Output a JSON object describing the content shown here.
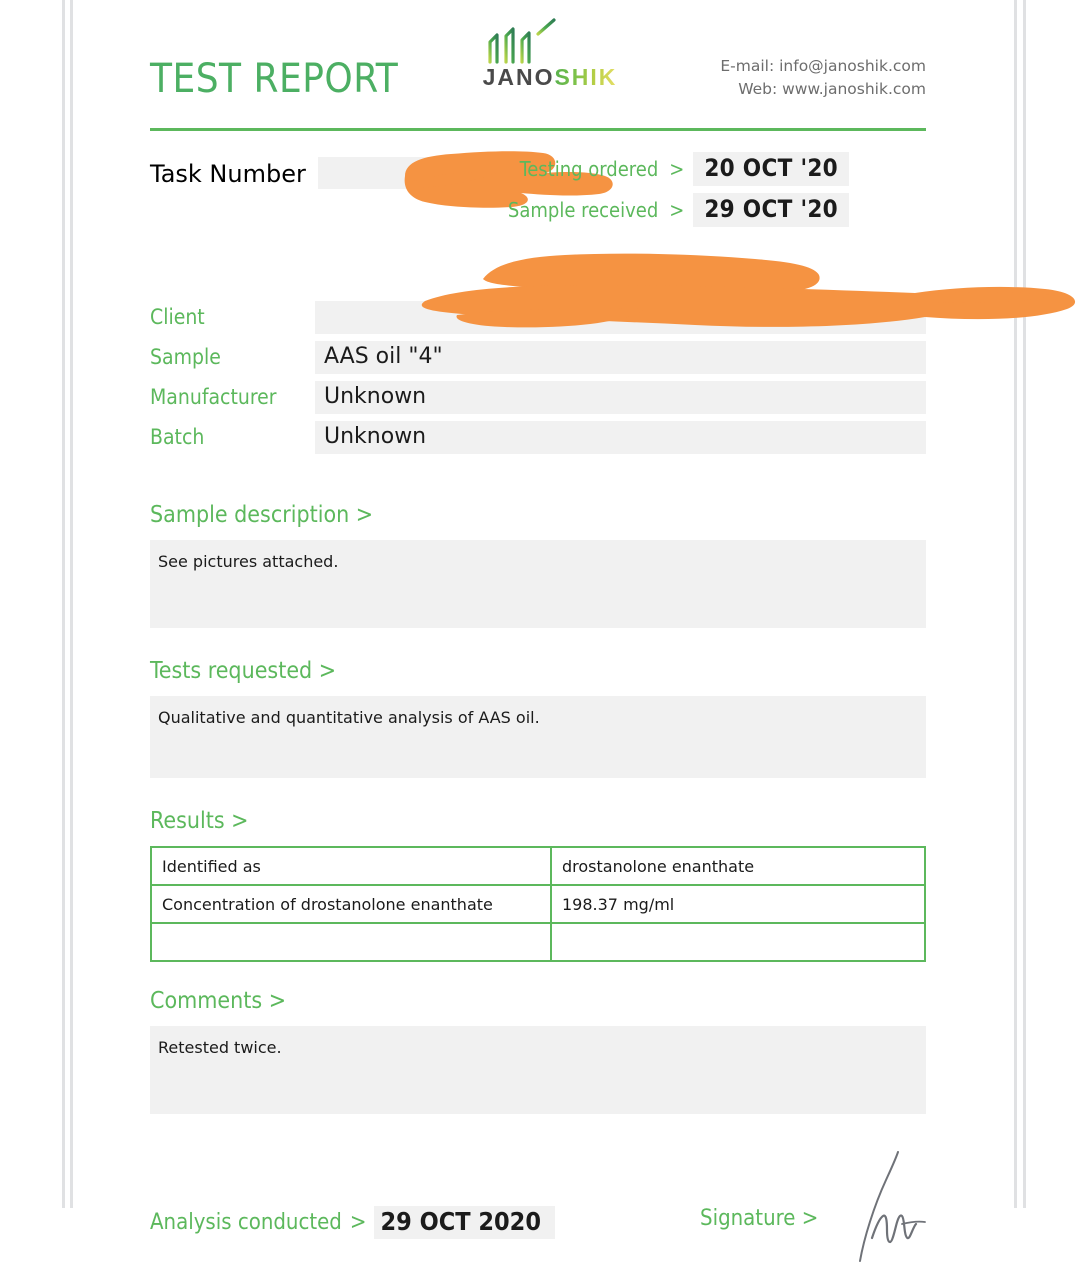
{
  "document": {
    "title": "TEST REPORT",
    "logo": {
      "name_dark": "JANO",
      "name_accent": "SHIK",
      "mark": "bar-chart-arrow-icon"
    },
    "contact": {
      "email_line": "E-mail: info@janoshik.com",
      "web_line": "Web: www.janoshik.com"
    }
  },
  "task": {
    "label": "Task Number",
    "value": "",
    "redacted": true
  },
  "dates": {
    "ordered_label": "Testing ordered",
    "ordered_value": "20 OCT '20",
    "received_label": "Sample received",
    "received_value": "29 OCT '20",
    "caret": ">"
  },
  "info": {
    "rows": [
      {
        "label": "Client",
        "value": "",
        "redacted": true
      },
      {
        "label": "Sample",
        "value": "AAS oil \"4\"",
        "redacted": false
      },
      {
        "label": "Manufacturer",
        "value": "Unknown",
        "redacted": false
      },
      {
        "label": "Batch",
        "value": "Unknown",
        "redacted": false
      }
    ]
  },
  "sections": {
    "description": {
      "heading": "Sample description >",
      "text": "See pictures attached."
    },
    "tests_requested": {
      "heading": "Tests requested >",
      "text": "Qualitative and quantitative analysis of AAS oil."
    },
    "results": {
      "heading": "Results >",
      "rows": [
        {
          "parameter": "Identified as",
          "value": "drostanolone enanthate"
        },
        {
          "parameter": "Concentration of drostanolone enanthate",
          "value": "198.37 mg/ml"
        },
        {
          "parameter": "",
          "value": ""
        }
      ]
    },
    "comments": {
      "heading": "Comments >",
      "text": "Retested twice."
    }
  },
  "footer": {
    "analysis_label": "Analysis conducted",
    "analysis_caret": ">",
    "analysis_date": "29 OCT 2020",
    "signature_label": "Signature >",
    "signature": "handwritten-signature"
  },
  "colors": {
    "green": "#5CB85C",
    "title_green": "#4CAF63",
    "redaction_orange": "#F59342",
    "field_gray": "#f1f1f1"
  }
}
